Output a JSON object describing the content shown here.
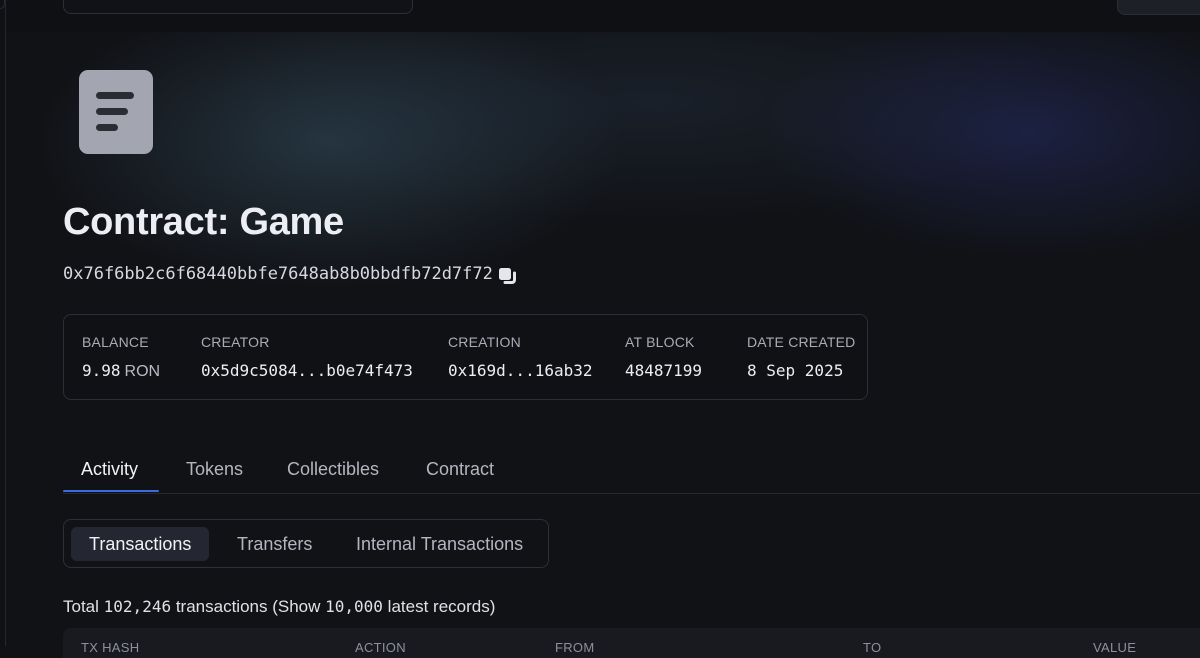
{
  "contract": {
    "title": "Contract: Game",
    "address": "0x76f6bb2c6f68440bbfe7648ab8b0bbdfb72d7f72"
  },
  "stats": {
    "balance": {
      "label": "BALANCE",
      "value": "9.98",
      "unit": "RON"
    },
    "creator": {
      "label": "CREATOR",
      "value": "0x5d9c5084...b0e74f473"
    },
    "creation": {
      "label": "CREATION",
      "value": "0x169d...16ab32"
    },
    "at_block": {
      "label": "AT BLOCK",
      "value": "48487199"
    },
    "date_created": {
      "label": "DATE CREATED",
      "value": "8 Sep 2025"
    }
  },
  "tabs": [
    {
      "label": "Activity",
      "active": true
    },
    {
      "label": "Tokens",
      "active": false
    },
    {
      "label": "Collectibles",
      "active": false
    },
    {
      "label": "Contract",
      "active": false
    }
  ],
  "subtabs": [
    {
      "label": "Transactions",
      "active": true
    },
    {
      "label": "Transfers",
      "active": false
    },
    {
      "label": "Internal Transactions",
      "active": false
    }
  ],
  "summary": {
    "prefix": "Total",
    "total": "102,246",
    "middle": "transactions (Show",
    "shown": "10,000",
    "suffix": "latest records)"
  },
  "table": {
    "columns": [
      "TX HASH",
      "ACTION",
      "FROM",
      "TO",
      "VALUE"
    ]
  },
  "icons": {
    "avatar": "document-lines-icon",
    "copy": "copy-icon"
  },
  "colors": {
    "background": "#111216",
    "accent": "#3b6bde",
    "avatar": "#a3a6b0"
  }
}
